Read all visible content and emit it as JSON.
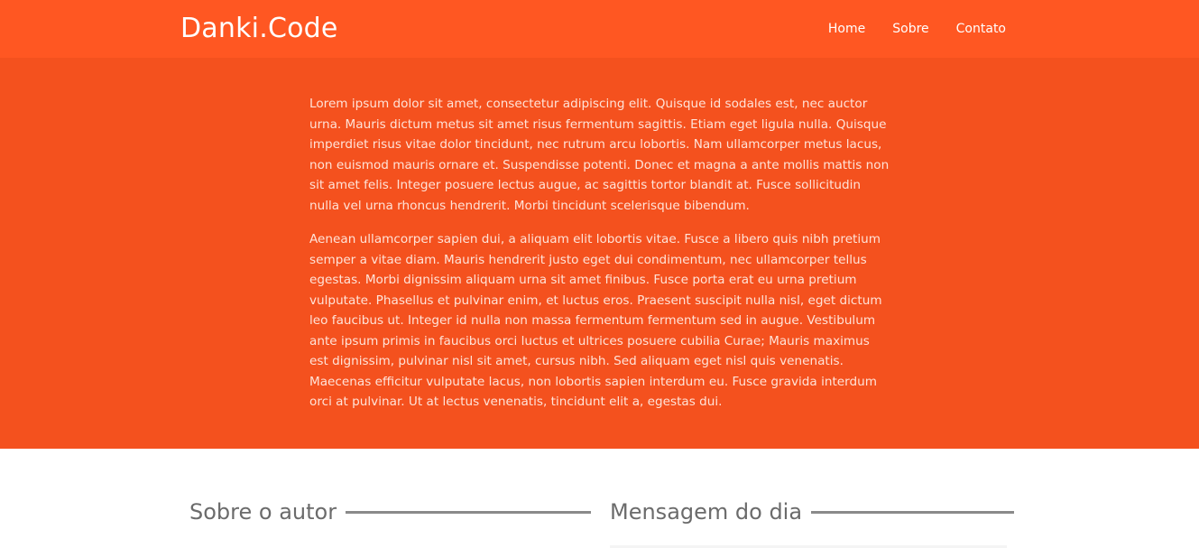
{
  "header": {
    "logo": "Danki.Code",
    "nav": [
      {
        "label": "Home"
      },
      {
        "label": "Sobre"
      },
      {
        "label": "Contato"
      }
    ]
  },
  "hero": {
    "paragraphs": [
      "Lorem ipsum dolor sit amet, consectetur adipiscing elit. Quisque id sodales est, nec auctor urna. Mauris dictum metus sit amet risus fermentum sagittis. Etiam eget ligula nulla. Quisque imperdiet risus vitae dolor tincidunt, nec rutrum arcu lobortis. Nam ullamcorper metus lacus, non euismod mauris ornare et. Suspendisse potenti. Donec et magna a ante mollis mattis non sit amet felis. Integer posuere lectus augue, ac sagittis tortor blandit at. Fusce sollicitudin nulla vel urna rhoncus hendrerit. Morbi tincidunt scelerisque bibendum.",
      "Aenean ullamcorper sapien dui, a aliquam elit lobortis vitae. Fusce a libero quis nibh pretium semper a vitae diam. Mauris hendrerit justo eget dui condimentum, nec ullamcorper tellus egestas. Morbi dignissim aliquam urna sit amet finibus. Fusce porta erat eu urna pretium vulputate. Phasellus et pulvinar enim, et luctus eros. Praesent suscipit nulla nisl, eget dictum leo faucibus ut. Integer id nulla non massa fermentum fermentum sed in augue. Vestibulum ante ipsum primis in faucibus orci luctus et ultrices posuere cubilia Curae; Mauris maximus est dignissim, pulvinar nisl sit amet, cursus nibh. Sed aliquam eget nisl quis venenatis. Maecenas efficitur vulputate lacus, non lobortis sapien interdum eu. Fusce gravida interdum orci at pulvinar. Ut at lectus venenatis, tincidunt elit a, egestas dui."
    ]
  },
  "sections": {
    "author_title": "Sobre o autor",
    "message_title": "Mensagem do dia"
  },
  "colors": {
    "header_bg": "#ff5722",
    "hero_bg": "#f4511e",
    "hero_text": "#ffe3d8",
    "section_title": "#6b6b6b",
    "rule": "#8a8a8a"
  }
}
